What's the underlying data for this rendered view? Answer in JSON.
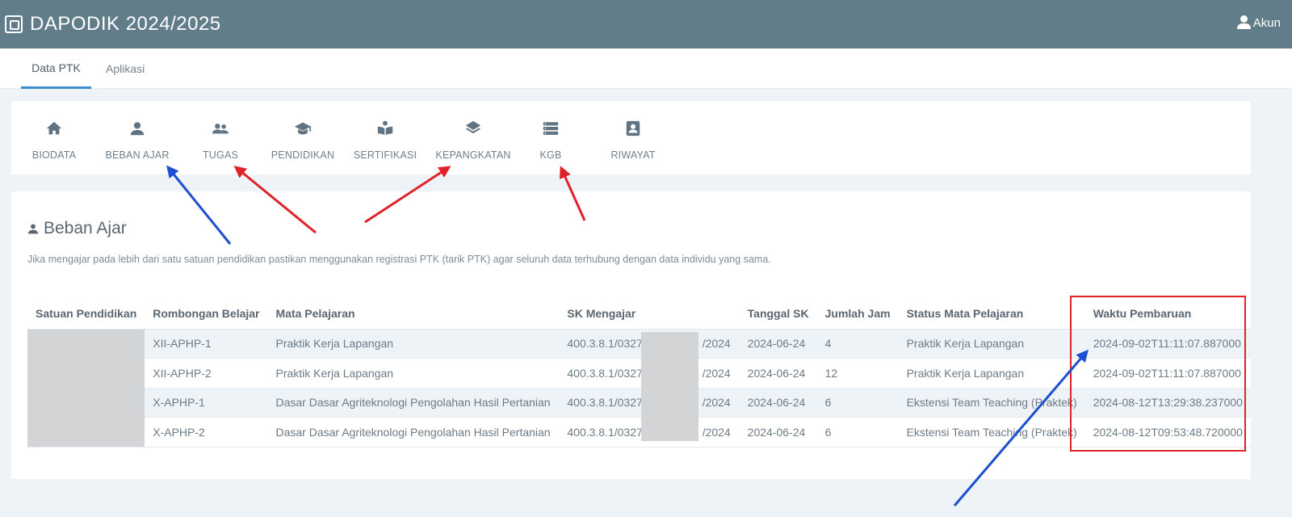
{
  "app": {
    "title": "DAPODIK 2024/2025",
    "account_label": "Akun"
  },
  "tabs": [
    {
      "label": "Data PTK",
      "active": true
    },
    {
      "label": "Aplikasi",
      "active": false
    }
  ],
  "subnav": [
    {
      "label": "BIODATA",
      "icon": "home-icon"
    },
    {
      "label": "BEBAN AJAR",
      "icon": "user-icon"
    },
    {
      "label": "TUGAS",
      "icon": "users-icon"
    },
    {
      "label": "PENDIDIKAN",
      "icon": "graduation-cap-icon"
    },
    {
      "label": "SERTIFIKASI",
      "icon": "book-reader-icon"
    },
    {
      "label": "KEPANGKATAN",
      "icon": "layers-icon"
    },
    {
      "label": "KGB",
      "icon": "server-icon"
    },
    {
      "label": "RIWAYAT",
      "icon": "id-badge-icon"
    }
  ],
  "section": {
    "title": "Beban Ajar",
    "note": "Jika mengajar pada lebih dari satu satuan pendidikan pastikan menggunakan registrasi PTK (tarik PTK) agar seluruh data terhubung dengan data individu yang sama."
  },
  "table": {
    "columns": [
      "Satuan Pendidikan",
      "Rombongan Belajar",
      "Mata Pelajaran",
      "SK Mengajar",
      "Tanggal SK",
      "Jumlah Jam",
      "Status Mata Pelajaran",
      "Waktu Pembaruan"
    ],
    "rows": [
      {
        "rombel": "XII-APHP-1",
        "mapel": "Praktik Kerja Lapangan",
        "sk_prefix": "400.3.8.1/0327/",
        "sk_suffix": "/2024",
        "tanggal": "2024-06-24",
        "jam": "4",
        "status": "Praktik Kerja Lapangan",
        "waktu": "2024-09-02T11:11:07.887000"
      },
      {
        "rombel": "XII-APHP-2",
        "mapel": "Praktik Kerja Lapangan",
        "sk_prefix": "400.3.8.1/0327/",
        "sk_suffix": "/2024",
        "tanggal": "2024-06-24",
        "jam": "12",
        "status": "Praktik Kerja Lapangan",
        "waktu": "2024-09-02T11:11:07.887000"
      },
      {
        "rombel": "X-APHP-1",
        "mapel": "Dasar Dasar Agriteknologi Pengolahan Hasil Pertanian",
        "sk_prefix": "400.3.8.1/0327/",
        "sk_suffix": "/2024",
        "tanggal": "2024-06-24",
        "jam": "6",
        "status": "Ekstensi Team Teaching (Praktek)",
        "waktu": "2024-08-12T13:29:38.237000"
      },
      {
        "rombel": "X-APHP-2",
        "mapel": "Dasar Dasar Agriteknologi Pengolahan Hasil Pertanian",
        "sk_prefix": "400.3.8.1/0327/",
        "sk_suffix": "/2024",
        "tanggal": "2024-06-24",
        "jam": "6",
        "status": "Ekstensi Team Teaching (Praktek)",
        "waktu": "2024-08-12T09:53:48.720000"
      }
    ]
  },
  "colors": {
    "header": "#627d8a",
    "accent": "#3b8dc7",
    "annotation_red": "#e02228",
    "annotation_blue": "#1d4fd0"
  }
}
